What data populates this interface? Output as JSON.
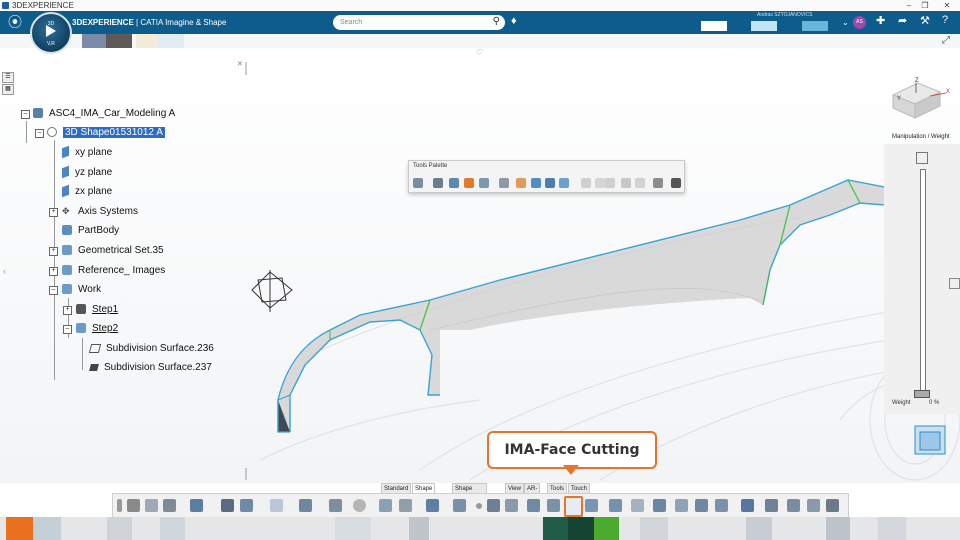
{
  "window": {
    "title": "3DEXPERIENCE"
  },
  "header": {
    "brand_bold": "3DEXPERIENCE",
    "brand_rest": " | CATIA  Imagine & Shape",
    "compass_top": "3D",
    "compass_bottom": "V,R",
    "search_placeholder": "Search",
    "user_name": "Andras SZTOJANOVICS",
    "avatar_initials": "AS"
  },
  "tree": {
    "root": "ASC4_IMA_Car_Modeling A",
    "shape": "3D Shape01531012 A",
    "items": [
      {
        "label": "xy plane"
      },
      {
        "label": "yz plane"
      },
      {
        "label": "zx plane"
      },
      {
        "label": "Axis Systems"
      },
      {
        "label": "PartBody"
      },
      {
        "label": "Geometrical Set.35"
      },
      {
        "label": "Reference_ Images"
      },
      {
        "label": "Work"
      },
      {
        "label": "Step1"
      },
      {
        "label": "Step2"
      },
      {
        "label": "Subdivision Surface.236"
      },
      {
        "label": "Subdivision Surface.237"
      }
    ]
  },
  "palette": {
    "title": "Tools Palette"
  },
  "manipulation": {
    "title": "Manipulation / Weight",
    "weight_label": "Weight",
    "weight_value": "0 %"
  },
  "compass_axes": {
    "x": "X",
    "y": "Y",
    "z": "Z"
  },
  "callout": {
    "text": "IMA-Face Cutting"
  },
  "tabs": [
    {
      "label": "Standard",
      "active": false
    },
    {
      "label": "Shape Sculpt",
      "active": true
    },
    {
      "label": "Shape Operations",
      "active": false
    },
    {
      "label": "View",
      "active": false
    },
    {
      "label": "AR-VR",
      "active": false
    },
    {
      "label": "Tools",
      "active": false
    },
    {
      "label": "Touch",
      "active": false
    }
  ],
  "colors": {
    "topbar": "#0e5c8c",
    "selection": "#2e6bc6",
    "callout_border": "#e8732b",
    "surface_edge": "#3aa3d6",
    "surface_fill": "#d9d9d9",
    "crease": "#3cc23c"
  },
  "icons": [
    "search-icon",
    "tag-icon",
    "share-icon",
    "tools-icon",
    "help-icon",
    "plus-icon",
    "maximize-icon",
    "heart-icon"
  ]
}
